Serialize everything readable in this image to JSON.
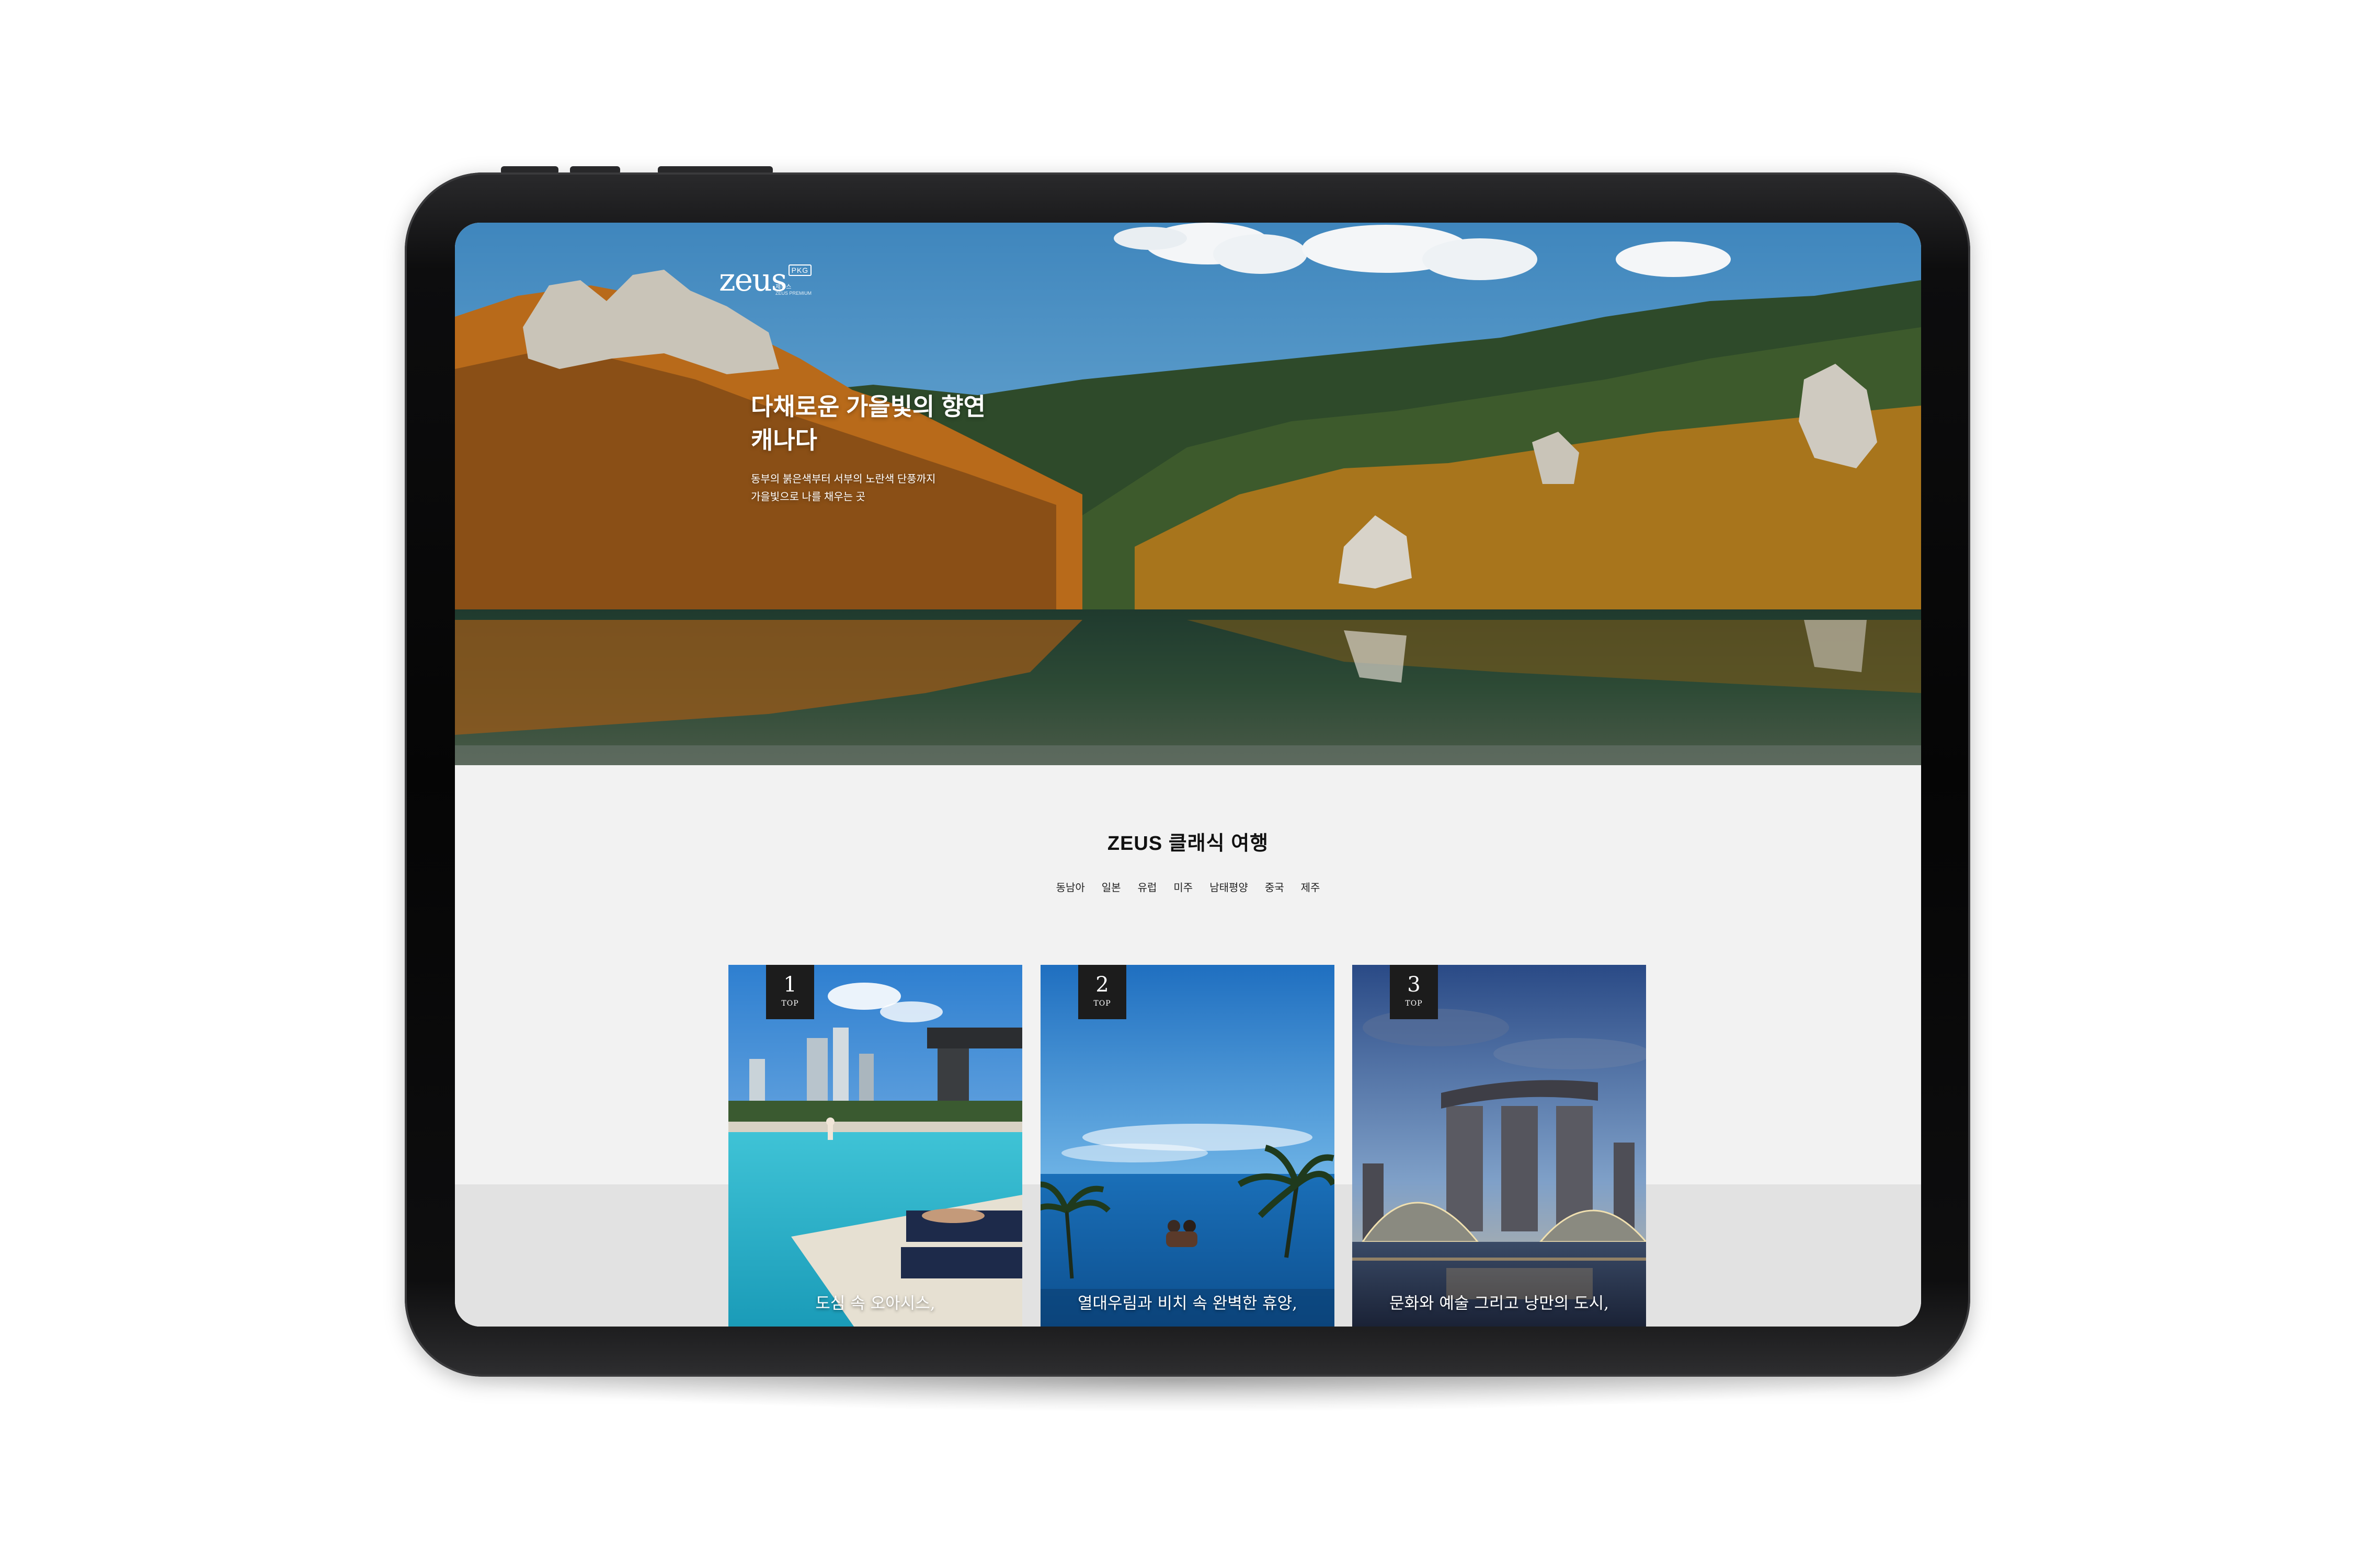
{
  "logo": {
    "word": "zeus",
    "badge": "PKG",
    "sub": "제우스",
    "sub2": "ZEUS PREMIUM"
  },
  "hero": {
    "title_line1": "다채로운 가을빛의 향연",
    "title_line2": "캐나다",
    "desc_line1": "동부의 붉은색부터 서부의 노란색 단풍까지",
    "desc_line2": "가을빛으로 나를 채우는 곳"
  },
  "section": {
    "title": "ZEUS 클래식 여행",
    "tabs": [
      "동남아",
      "일본",
      "유럽",
      "미주",
      "남태평양",
      "중국",
      "제주"
    ]
  },
  "cards": [
    {
      "rank": "1",
      "rank_label": "TOP",
      "caption": "도심 속 오아시스,"
    },
    {
      "rank": "2",
      "rank_label": "TOP",
      "caption": "열대우림과 비치 속 완벽한 휴양,"
    },
    {
      "rank": "3",
      "rank_label": "TOP",
      "caption": "문화와 예술 그리고 낭만의 도시,"
    }
  ],
  "colors": {
    "page_bg": "#f2f2f2",
    "rank_bg": "#1c1c1c",
    "device_frame": "#0a0a0a"
  }
}
